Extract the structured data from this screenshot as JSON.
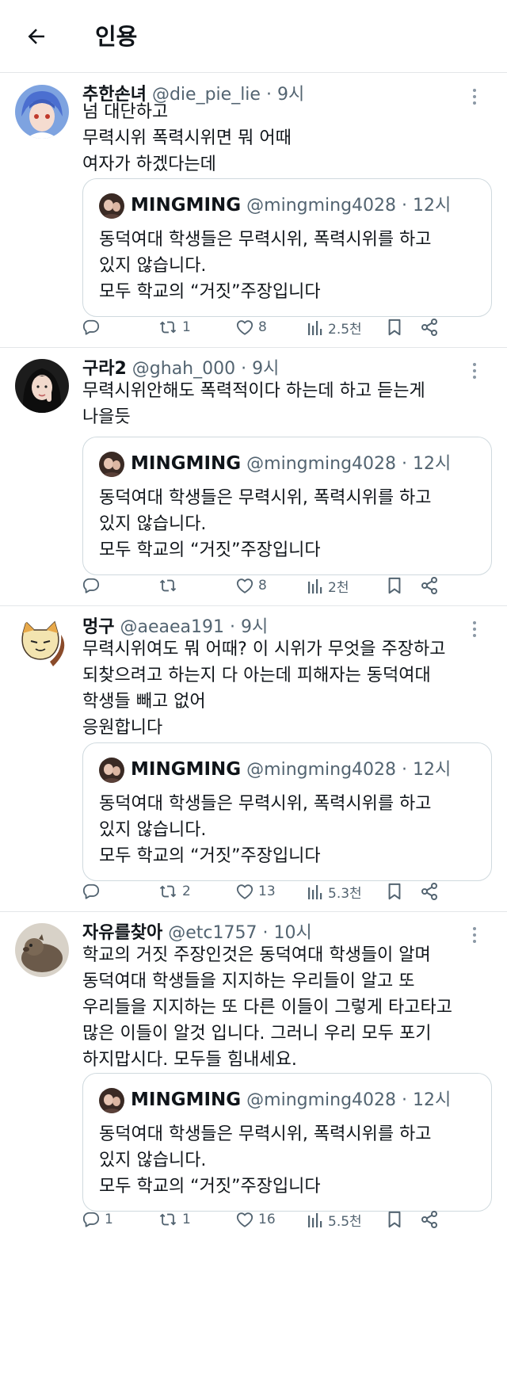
{
  "header": {
    "title": "인용",
    "back_icon": "arrow-left-icon"
  },
  "quoted": {
    "name": "MINGMING",
    "handle": "@mingming4028",
    "time": "12시",
    "lines": [
      "동덕여대 학생들은 무력시위, 폭력시위를 하고",
      "있지 않습니다.",
      "모두 학교의 “거짓”주장입니다"
    ]
  },
  "separator": "·",
  "tweets": [
    {
      "name": "추한손녀",
      "handle": "@die_pie_lie",
      "time": "9시",
      "lines": [
        "넘 대단하고",
        "무력시위 폭력시위면 뭐 어때",
        "여자가 하겠다는데"
      ],
      "replies": "",
      "retweets": "1",
      "likes": "8",
      "views": "2.5천"
    },
    {
      "name": "구라2",
      "handle": "@ghah_000",
      "time": "9시",
      "lines": [
        "무력시위안해도 폭력적이다 하는데 하고 듣는게",
        "나을듯"
      ],
      "replies": "",
      "retweets": "",
      "likes": "8",
      "views": "2천"
    },
    {
      "name": "멍구",
      "handle": "@aeaea191",
      "time": "9시",
      "lines": [
        "무력시위여도 뭐 어때? 이 시위가 무엇을 주장하고",
        "되찾으려고 하는지 다 아는데 피해자는 동덕여대",
        "학생들 빼고 없어",
        "응원합니다"
      ],
      "replies": "",
      "retweets": "2",
      "likes": "13",
      "views": "5.3천"
    },
    {
      "name": "자유를찾아",
      "handle": "@etc1757",
      "time": "10시",
      "lines": [
        "학교의 거짓 주장인것은 동덕여대 학생들이 알며",
        "동덕여대 학생들을 지지하는 우리들이 알고 또",
        "우리들을 지지하는 또 다른 이들이 그렇게 타고타고",
        "많은 이들이 알것 입니다. 그러니 우리 모두 포기",
        "하지맙시다. 모두들 힘내세요."
      ],
      "replies": "1",
      "retweets": "1",
      "likes": "16",
      "views": "5.5천"
    }
  ],
  "icons": {
    "reply": "reply-icon",
    "retweet": "retweet-icon",
    "like": "heart-icon",
    "views": "views-icon",
    "bookmark": "bookmark-icon",
    "share": "share-icon",
    "more": "more-icon"
  },
  "colors": {
    "text": "#0f1419",
    "secondary": "#536471",
    "border": "#cfd9de",
    "divider": "#e3e6e9"
  }
}
